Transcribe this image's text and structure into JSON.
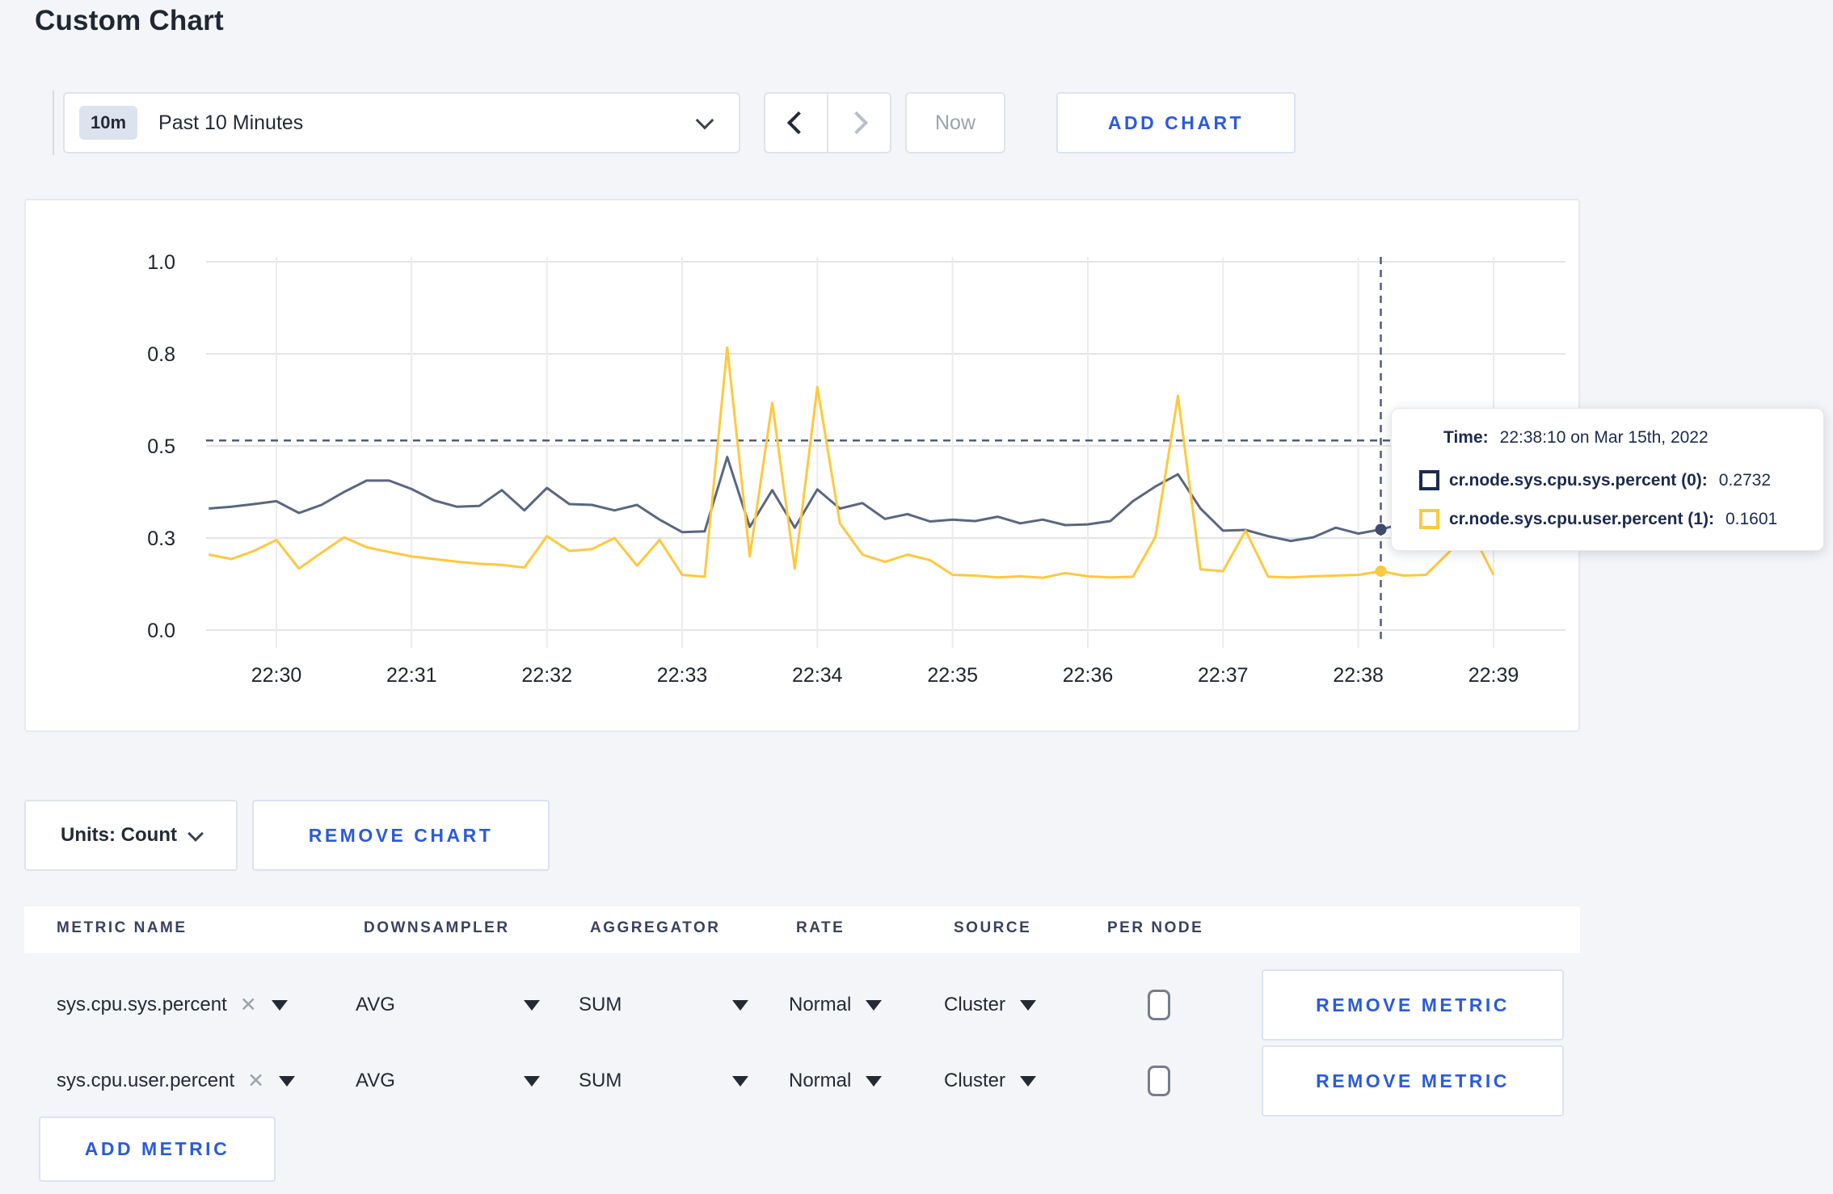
{
  "page_title": "Custom Chart",
  "toolbar": {
    "time_badge": "10m",
    "time_label": "Past 10 Minutes",
    "now_label": "Now",
    "add_chart_label": "ADD CHART"
  },
  "chart_data": {
    "type": "line",
    "title": "",
    "xlabel": "",
    "ylabel": "",
    "ylim": [
      0,
      1
    ],
    "grid": true,
    "legend_position": "none",
    "x_start": "22:29:30",
    "x_interval_seconds": 10,
    "x_ticks": [
      "22:30",
      "22:31",
      "22:32",
      "22:33",
      "22:34",
      "22:35",
      "22:36",
      "22:37",
      "22:38",
      "22:39"
    ],
    "y_ticks": [
      {
        "value": 0.0,
        "label": "0.0"
      },
      {
        "value": 0.25,
        "label": "0.3"
      },
      {
        "value": 0.5,
        "label": "0.5"
      },
      {
        "value": 0.75,
        "label": "0.8"
      },
      {
        "value": 1.0,
        "label": "1.0"
      }
    ],
    "series": [
      {
        "name": "cr.node.sys.cpu.sys.percent",
        "color": "#5b6680",
        "values": [
          0.33,
          0.335,
          0.342,
          0.35,
          0.318,
          0.34,
          0.375,
          0.406,
          0.406,
          0.383,
          0.352,
          0.335,
          0.337,
          0.38,
          0.325,
          0.386,
          0.342,
          0.34,
          0.325,
          0.34,
          0.3,
          0.266,
          0.268,
          0.47,
          0.28,
          0.38,
          0.278,
          0.382,
          0.33,
          0.345,
          0.302,
          0.315,
          0.295,
          0.3,
          0.296,
          0.308,
          0.29,
          0.3,
          0.285,
          0.287,
          0.296,
          0.35,
          0.39,
          0.423,
          0.33,
          0.27,
          0.272,
          0.255,
          0.242,
          0.252,
          0.278,
          0.262,
          0.2732,
          0.29,
          0.3,
          0.295,
          0.3,
          0.295
        ]
      },
      {
        "name": "cr.node.sys.cpu.user.percent",
        "color": "#ffc83d",
        "values": [
          0.205,
          0.193,
          0.215,
          0.245,
          0.167,
          0.21,
          0.252,
          0.225,
          0.212,
          0.2,
          0.193,
          0.186,
          0.18,
          0.177,
          0.17,
          0.255,
          0.215,
          0.22,
          0.25,
          0.175,
          0.245,
          0.15,
          0.145,
          0.767,
          0.2,
          0.617,
          0.167,
          0.66,
          0.29,
          0.205,
          0.185,
          0.205,
          0.19,
          0.15,
          0.148,
          0.143,
          0.146,
          0.142,
          0.155,
          0.146,
          0.143,
          0.145,
          0.253,
          0.636,
          0.165,
          0.16,
          0.27,
          0.145,
          0.143,
          0.146,
          0.148,
          0.15,
          0.1601,
          0.148,
          0.15,
          0.21,
          0.27,
          0.15
        ]
      }
    ],
    "crosshair": {
      "index": 52,
      "time": "22:38:10",
      "hline_value": 0.515
    }
  },
  "tooltip": {
    "time_label": "Time:",
    "time_value": "22:38:10 on Mar 15th, 2022",
    "rows": [
      {
        "label": "cr.node.sys.cpu.sys.percent (0):",
        "value": "0.2732",
        "swatch_color": "#1b2a4e"
      },
      {
        "label": "cr.node.sys.cpu.user.percent (1):",
        "value": "0.1601",
        "swatch_color": "#ffc83d"
      }
    ]
  },
  "chart_footer": {
    "units_label": "Units: Count",
    "remove_chart_label": "REMOVE CHART"
  },
  "metrics_table": {
    "columns": [
      "METRIC NAME",
      "DOWNSAMPLER",
      "AGGREGATOR",
      "RATE",
      "SOURCE",
      "PER NODE"
    ],
    "rows": [
      {
        "metric": "sys.cpu.sys.percent",
        "downsampler": "AVG",
        "aggregator": "SUM",
        "rate": "Normal",
        "source": "Cluster",
        "per_node_checked": false,
        "remove_label": "REMOVE METRIC"
      },
      {
        "metric": "sys.cpu.user.percent",
        "downsampler": "AVG",
        "aggregator": "SUM",
        "rate": "Normal",
        "source": "Cluster",
        "per_node_checked": false,
        "remove_label": "REMOVE METRIC"
      }
    ],
    "add_metric_label": "ADD METRIC"
  },
  "colors": {
    "accent_blue": "#2a5adf",
    "page_background": "#f4f5f8",
    "crosshair": "#4e5d7c"
  }
}
